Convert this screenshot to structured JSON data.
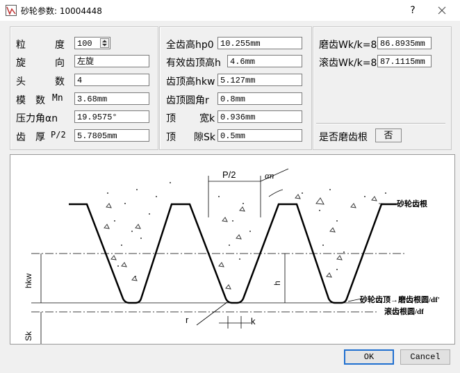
{
  "window": {
    "title": "砂轮参数: 10004448",
    "help": "?",
    "close": "✕"
  },
  "left": {
    "grit_label": "粒 度",
    "grit_value": "100",
    "rotation_label": "旋 向",
    "rotation_value": "左旋",
    "starts_label": "头 数",
    "starts_value": "4",
    "module_label": "模 数 Mn",
    "module_value": "3.68mm",
    "pressure_label": "压力角αn",
    "pressure_value": "19.9575°",
    "thickness_label": "齿 厚 P/2",
    "thickness_value": "5.7805mm"
  },
  "middle": {
    "full_height_label": "全齿高hp0",
    "full_height_value": "10.255mm",
    "eff_height_label": "有效齿顶高h",
    "eff_height_value": "4.6mm",
    "tip_height_label": "齿顶高hkw",
    "tip_height_value": "5.127mm",
    "tip_radius_label": "齿顶圆角r",
    "tip_radius_value": "0.8mm",
    "tip_width_label": "顶 宽k",
    "tip_width_value": "0.936mm",
    "clearance_label": "顶 隙Sk",
    "clearance_value": "0.5mm"
  },
  "right": {
    "grind_wk_label": "磨齿Wk/k=8",
    "grind_wk_value": "86.8935mm",
    "hob_wk_label": "滚齿Wk/k=8",
    "hob_wk_value": "87.1115mm",
    "grind_root_label": "是否磨齿根",
    "grind_root_value": "否"
  },
  "diagram": {
    "p2": "P/2",
    "alpha": "αn",
    "wheel_root": "砂轮齿根",
    "wheel_tip": "砂轮齿顶→磨齿根圆/df'",
    "hob_root": "滚齿根圆/df",
    "hkw": "hkw",
    "sk": "Sk",
    "h": "h",
    "r": "r",
    "k": "k"
  },
  "buttons": {
    "ok": "OK",
    "cancel": "Cancel"
  }
}
